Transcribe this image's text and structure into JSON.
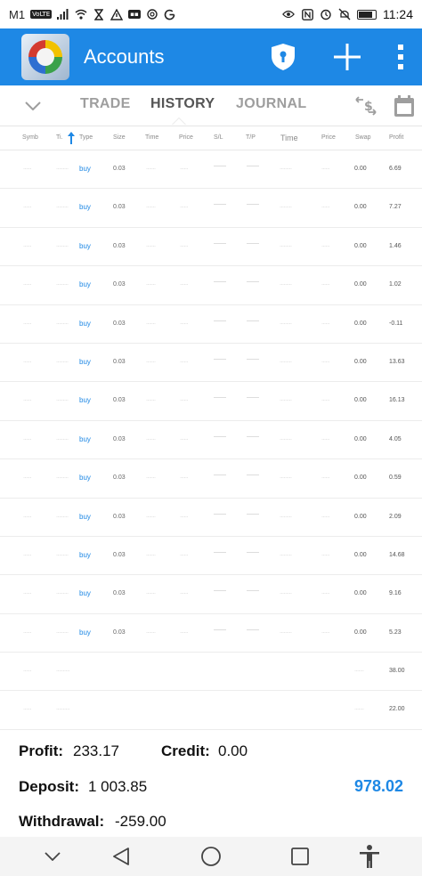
{
  "status_bar": {
    "carrier": "M1",
    "volte_badge": "VoLTE",
    "time": "11:24",
    "battery_level": 0.85,
    "left_icons": [
      "signal-icon",
      "wifi-icon",
      "hourglass-icon",
      "warning-icon",
      "notification-box-icon",
      "settings-flower-icon",
      "google-icon"
    ],
    "right_icons": [
      "eye-icon",
      "nfc-icon",
      "alarm-icon",
      "mute-icon",
      "battery-icon"
    ]
  },
  "app_bar": {
    "title": "Accounts",
    "icons": [
      "metatrader-logo-icon",
      "shield-lock-icon",
      "plus-icon",
      "overflow-menu-icon"
    ],
    "accent_color": "#1e88e5"
  },
  "tabs": {
    "items": [
      {
        "label": "TRADE",
        "active": false
      },
      {
        "label": "HISTORY",
        "active": true
      },
      {
        "label": "JOURNAL",
        "active": false
      }
    ],
    "icons": [
      "chevron-down-icon",
      "currency-exchange-icon",
      "calendar-icon"
    ]
  },
  "table": {
    "columns": {
      "symbol": "Symb",
      "ticket": "Ti.",
      "type": "Type",
      "size": "Size",
      "open_time": "Time",
      "open_price": "Price",
      "sl": "S/L",
      "tp": "T/P",
      "close_time": "Time",
      "close_price": "Price",
      "swap": "Swap",
      "profit": "Profit"
    },
    "rows": [
      {
        "symbol": "······",
        "ticket": "·········",
        "type": "buy",
        "size": "0.03",
        "open_time": "·······",
        "open_price": "······",
        "sl": "——",
        "tp": "——",
        "close_time": "·········",
        "close_price": "······",
        "swap": "0.00",
        "profit": "6.69"
      },
      {
        "symbol": "······",
        "ticket": "·········",
        "type": "buy",
        "size": "0.03",
        "open_time": "·······",
        "open_price": "······",
        "sl": "——",
        "tp": "——",
        "close_time": "·········",
        "close_price": "······",
        "swap": "0.00",
        "profit": "7.27"
      },
      {
        "symbol": "······",
        "ticket": "·········",
        "type": "buy",
        "size": "0.03",
        "open_time": "·······",
        "open_price": "······",
        "sl": "——",
        "tp": "——",
        "close_time": "·········",
        "close_price": "······",
        "swap": "0.00",
        "profit": "1.46"
      },
      {
        "symbol": "······",
        "ticket": "·········",
        "type": "buy",
        "size": "0.03",
        "open_time": "·······",
        "open_price": "······",
        "sl": "——",
        "tp": "——",
        "close_time": "·········",
        "close_price": "······",
        "swap": "0.00",
        "profit": "1.02"
      },
      {
        "symbol": "······",
        "ticket": "·········",
        "type": "buy",
        "size": "0.03",
        "open_time": "·······",
        "open_price": "······",
        "sl": "——",
        "tp": "——",
        "close_time": "·········",
        "close_price": "······",
        "swap": "0.00",
        "profit": "-0.11"
      },
      {
        "symbol": "······",
        "ticket": "·········",
        "type": "buy",
        "size": "0.03",
        "open_time": "·······",
        "open_price": "······",
        "sl": "——",
        "tp": "——",
        "close_time": "·········",
        "close_price": "······",
        "swap": "0.00",
        "profit": "13.63"
      },
      {
        "symbol": "······",
        "ticket": "·········",
        "type": "buy",
        "size": "0.03",
        "open_time": "·······",
        "open_price": "······",
        "sl": "——",
        "tp": "——",
        "close_time": "·········",
        "close_price": "······",
        "swap": "0.00",
        "profit": "16.13"
      },
      {
        "symbol": "······",
        "ticket": "·········",
        "type": "buy",
        "size": "0.03",
        "open_time": "·······",
        "open_price": "······",
        "sl": "——",
        "tp": "——",
        "close_time": "·········",
        "close_price": "······",
        "swap": "0.00",
        "profit": "4.05"
      },
      {
        "symbol": "······",
        "ticket": "·········",
        "type": "buy",
        "size": "0.03",
        "open_time": "·······",
        "open_price": "······",
        "sl": "——",
        "tp": "——",
        "close_time": "·········",
        "close_price": "······",
        "swap": "0.00",
        "profit": "0.59"
      },
      {
        "symbol": "······",
        "ticket": "·········",
        "type": "buy",
        "size": "0.03",
        "open_time": "·······",
        "open_price": "······",
        "sl": "——",
        "tp": "——",
        "close_time": "·········",
        "close_price": "······",
        "swap": "0.00",
        "profit": "2.09"
      },
      {
        "symbol": "······",
        "ticket": "·········",
        "type": "buy",
        "size": "0.03",
        "open_time": "·······",
        "open_price": "······",
        "sl": "——",
        "tp": "——",
        "close_time": "·········",
        "close_price": "······",
        "swap": "0.00",
        "profit": "14.68"
      },
      {
        "symbol": "······",
        "ticket": "·········",
        "type": "buy",
        "size": "0.03",
        "open_time": "·······",
        "open_price": "······",
        "sl": "——",
        "tp": "——",
        "close_time": "·········",
        "close_price": "······",
        "swap": "0.00",
        "profit": "9.16"
      },
      {
        "symbol": "······",
        "ticket": "·········",
        "type": "buy",
        "size": "0.03",
        "open_time": "·······",
        "open_price": "······",
        "sl": "——",
        "tp": "——",
        "close_time": "·········",
        "close_price": "······",
        "swap": "0.00",
        "profit": "5.23"
      },
      {
        "symbol": "······",
        "ticket": "··········",
        "type": "",
        "size": "",
        "open_time": "",
        "open_price": "",
        "sl": "",
        "tp": "",
        "close_time": "",
        "close_price": "",
        "swap": "·······",
        "profit": "38.00"
      },
      {
        "symbol": "······",
        "ticket": "··········",
        "type": "",
        "size": "",
        "open_time": "",
        "open_price": "",
        "sl": "",
        "tp": "",
        "close_time": "",
        "close_price": "",
        "swap": "·······",
        "profit": "22.00"
      }
    ]
  },
  "summary": {
    "profit_label": "Profit:",
    "profit_value": "233.17",
    "credit_label": "Credit:",
    "credit_value": "0.00",
    "deposit_label": "Deposit:",
    "deposit_value": "1 003.85",
    "withdrawal_label": "Withdrawal:",
    "withdrawal_value": "-259.00",
    "balance_value": "978.02"
  },
  "nav_bar": {
    "icons": [
      "chevron-down-icon",
      "back-triangle-icon",
      "home-circle-icon",
      "recents-square-icon",
      "accessibility-icon"
    ]
  }
}
